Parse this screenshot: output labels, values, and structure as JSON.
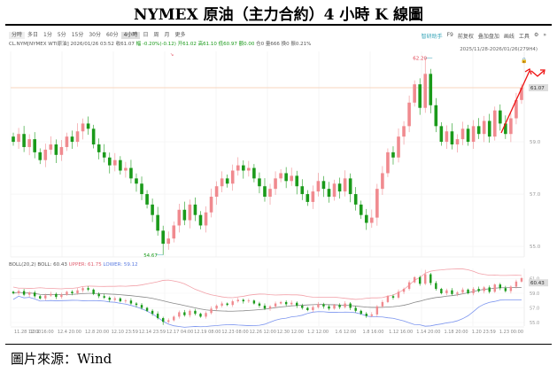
{
  "title": "NYMEX 原油（主力合約）4 小時 K 線圖",
  "footer": "圖片來源：Wind",
  "toolbar": {
    "periods": [
      "分時",
      "多日",
      "1分",
      "5分",
      "15分",
      "30分",
      "60分",
      "4小時",
      "日",
      "周",
      "月",
      "更多"
    ],
    "active": "4小時",
    "right_tools": [
      "智研助手",
      "F9",
      "前复权",
      "叠加盘加",
      "画线",
      "工具"
    ]
  },
  "info": {
    "symbol": "CL.NYM[NYMEX WTI原油]",
    "datetime": "2026/01/26 03:52",
    "close": "收61.07",
    "change": "幅 -0.20%(-0.12)",
    "open": "开61.02",
    "high": "高61.10",
    "low": "低60.97",
    "amount": "额0.00",
    "oi": "仓0",
    "volume": "量666",
    "hold": "换0",
    "amplitude": "振0.21%"
  },
  "range_label": "2025/11/28-2026/01/26(279H4)",
  "boll_label": {
    "name": "BOLL(20,2)",
    "mid": "BOLL: 60.43",
    "upper": "UPPER: 61.75",
    "lower": "LOWER: 59.12"
  },
  "colors": {
    "up": "#f08a8f",
    "down": "#1a9a1a",
    "upper": "#f2a0a8",
    "lower": "#7c95ef",
    "mid": "#888888",
    "arrow": "#ee1111",
    "last": "#f4c9a8"
  },
  "chart_data": {
    "type": "candlestick",
    "main": {
      "yticks": [
        55.0,
        57.0,
        59.0
      ],
      "last_price": "61.07",
      "max_label": "62.20",
      "min_label": "54.67",
      "ylim": [
        54.4,
        62.6
      ]
    },
    "sub": {
      "yticks": [
        55.0,
        57.0,
        59.0,
        61.0
      ],
      "last": "60.43",
      "ylim": [
        54.5,
        62.2
      ]
    },
    "xticks": [
      "11.28 12:00",
      "12.2 16:00",
      "12.4 20:00",
      "12.8 20:00",
      "12.10 23:59",
      "12.14 23:59",
      "12.17 04:00",
      "12.19 08:00",
      "12.23 08:00",
      "12.26 12:00",
      "12.30 12:00",
      "1.2 12:00",
      "1.6 12:00",
      "1.8 16:00",
      "1.12 16:00",
      "1.14 20:00",
      "1.18 20:00",
      "1.20 23:59",
      "1.23 00:00"
    ],
    "closes": [
      59.0,
      59.3,
      58.8,
      59.1,
      58.6,
      58.3,
      58.7,
      58.9,
      58.5,
      58.8,
      59.2,
      59.0,
      59.4,
      59.7,
      59.5,
      58.9,
      58.6,
      58.4,
      58.1,
      58.3,
      57.9,
      58.0,
      57.6,
      57.4,
      57.0,
      56.6,
      56.2,
      55.6,
      55.1,
      55.3,
      55.8,
      56.4,
      56.0,
      56.6,
      56.2,
      55.8,
      56.3,
      56.9,
      57.3,
      57.6,
      57.4,
      57.9,
      58.1,
      57.9,
      58.0,
      57.6,
      57.3,
      56.9,
      57.2,
      57.6,
      57.8,
      57.5,
      57.7,
      57.3,
      57.0,
      56.7,
      57.1,
      57.5,
      57.2,
      56.9,
      57.4,
      57.1,
      57.6,
      57.0,
      56.6,
      56.2,
      55.9,
      56.1,
      57.2,
      57.8,
      58.6,
      58.4,
      59.2,
      59.6,
      60.5,
      61.2,
      60.3,
      61.6,
      60.4,
      59.6,
      59.0,
      59.4,
      58.9,
      59.1,
      59.5,
      59.0,
      59.6,
      59.3,
      59.8,
      59.2,
      60.2,
      59.7,
      59.3,
      59.9,
      60.6,
      61.07
    ]
  }
}
